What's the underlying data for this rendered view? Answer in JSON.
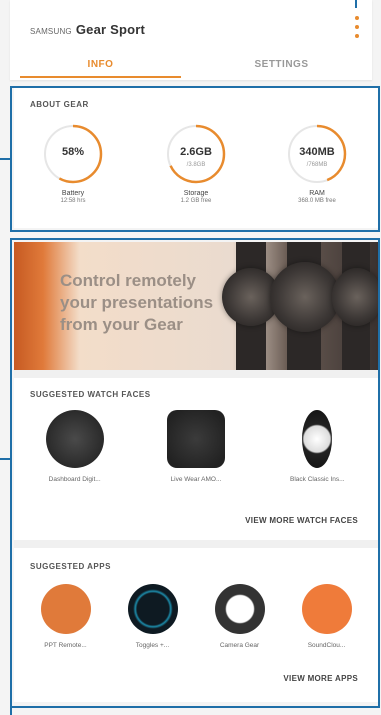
{
  "header": {
    "brand": "SAMSUNG",
    "title": "Gear Sport",
    "tabs": [
      {
        "label": "INFO",
        "active": true
      },
      {
        "label": "SETTINGS",
        "active": false
      }
    ],
    "more_icon": "more-vertical-icon"
  },
  "about_gear": {
    "title": "ABOUT GEAR",
    "gauges": [
      {
        "value": "58%",
        "sub": "",
        "label": "Battery",
        "detail": "12:58 hrs",
        "fraction": 0.58
      },
      {
        "value": "2.6GB",
        "sub": "/3.8GB",
        "label": "Storage",
        "detail": "1.2 GB free",
        "fraction": 0.68
      },
      {
        "value": "340MB",
        "sub": "/768MB",
        "label": "RAM",
        "detail": "368.0 MB free",
        "fraction": 0.44
      }
    ]
  },
  "promo": {
    "text": "Control remotely your presentations from your Gear"
  },
  "watch_faces": {
    "title": "SUGGESTED WATCH FACES",
    "items": [
      {
        "caption": "Dashboard Digit..."
      },
      {
        "caption": "Live Wear AMO..."
      },
      {
        "caption": "Black Classic Ins..."
      }
    ],
    "view_more": "VIEW MORE WATCH FACES"
  },
  "apps": {
    "title": "SUGGESTED APPS",
    "items": [
      {
        "caption": "PPT Remote..."
      },
      {
        "caption": "Toggles +..."
      },
      {
        "caption": "Camera Gear"
      },
      {
        "caption": "SoundClou..."
      }
    ],
    "view_more": "VIEW MORE APPS"
  },
  "colors": {
    "accent": "#e88b2e",
    "callout": "#1f6fa8"
  }
}
